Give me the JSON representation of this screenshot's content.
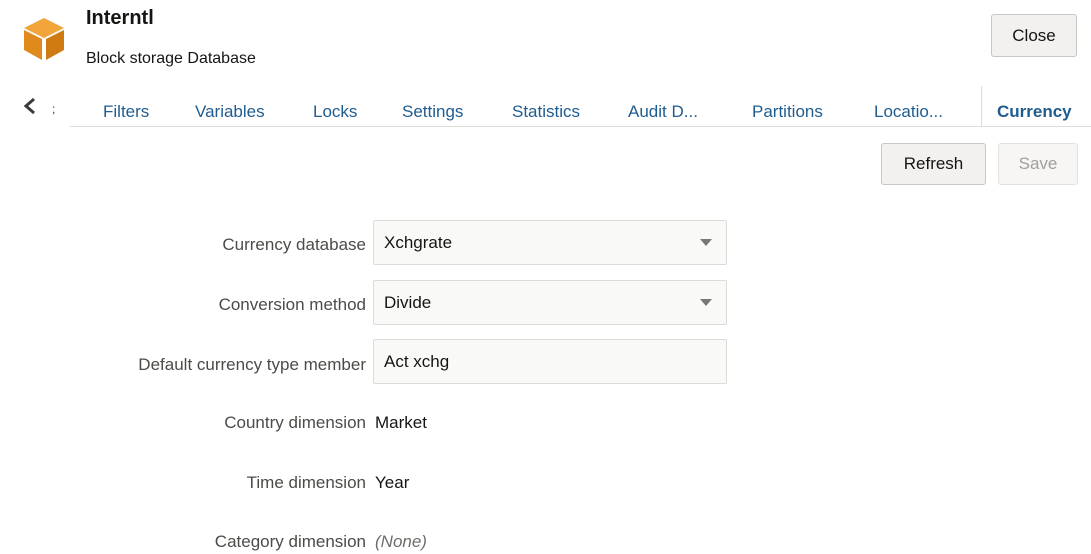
{
  "header": {
    "title": "Interntl",
    "subtitle": "Block storage Database",
    "close_label": "Close",
    "icon": "database-cube-icon",
    "icon_color": "#e8962a"
  },
  "tabs": [
    {
      "label": "Filters",
      "active": false
    },
    {
      "label": "Variables",
      "active": false
    },
    {
      "label": "Locks",
      "active": false
    },
    {
      "label": "Settings",
      "active": false
    },
    {
      "label": "Statistics",
      "active": false
    },
    {
      "label": "Audit D...",
      "active": false
    },
    {
      "label": "Partitions",
      "active": false
    },
    {
      "label": "Locatio...",
      "active": false
    },
    {
      "label": "Currency",
      "active": true
    }
  ],
  "toolbar": {
    "refresh_label": "Refresh",
    "save_label": "Save",
    "save_disabled": true
  },
  "form": {
    "currency_database": {
      "label": "Currency database",
      "value": "Xchgrate"
    },
    "conversion_method": {
      "label": "Conversion method",
      "value": "Divide"
    },
    "default_currency_type_member": {
      "label": "Default currency type member",
      "value": "Act xchg"
    },
    "country_dimension": {
      "label": "Country dimension",
      "value": "Market"
    },
    "time_dimension": {
      "label": "Time dimension",
      "value": "Year"
    },
    "category_dimension": {
      "label": "Category dimension",
      "value": "(None)"
    }
  },
  "colors": {
    "accent": "#1f5c8f",
    "icon_orange": "#e8962a"
  }
}
